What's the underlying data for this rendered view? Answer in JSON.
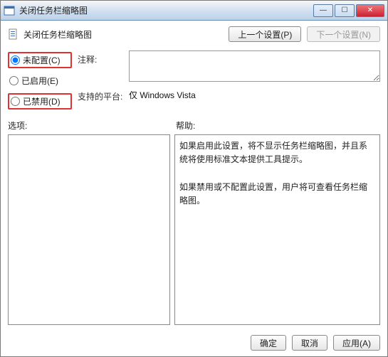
{
  "window": {
    "title": "关闭任务栏缩略图"
  },
  "header": {
    "title": "关闭任务栏缩略图",
    "prev_button": "上一个设置(P)",
    "next_button": "下一个设置(N)"
  },
  "radios": {
    "not_configured": "未配置(C)",
    "enabled": "已启用(E)",
    "disabled": "已禁用(D)",
    "selected": "not_configured"
  },
  "labels": {
    "comment": "注释:",
    "platform": "支持的平台:",
    "options": "选项:",
    "help": "帮助:"
  },
  "platform_value": "仅 Windows Vista",
  "help_text": {
    "p1": "如果启用此设置，将不显示任务栏缩略图，并且系统将使用标准文本提供工具提示。",
    "p2": "如果禁用或不配置此设置，用户将可查看任务栏缩略图。"
  },
  "footer": {
    "ok": "确定",
    "cancel": "取消",
    "apply": "应用(A)"
  }
}
